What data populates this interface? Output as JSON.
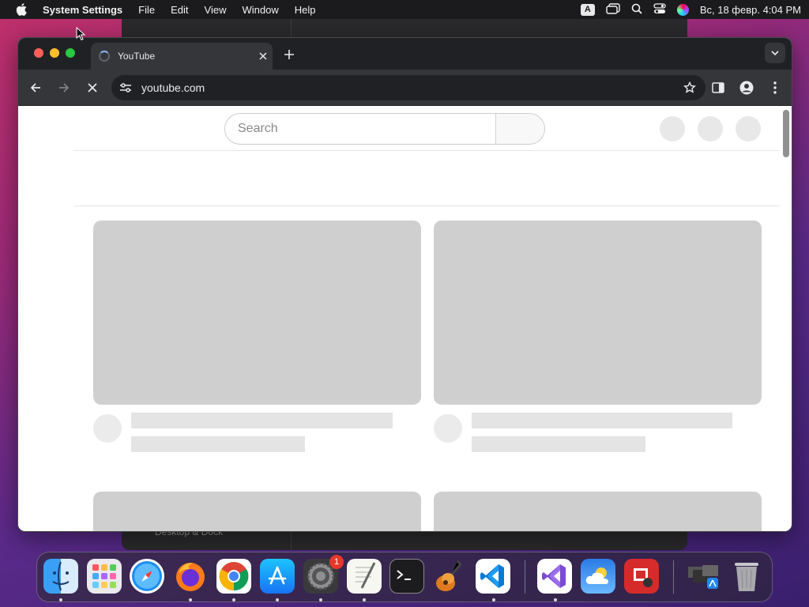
{
  "menubar": {
    "app_name": "System Settings",
    "menus": [
      "File",
      "Edit",
      "View",
      "Window",
      "Help"
    ],
    "input_source": "A",
    "datetime": "Вс, 18 февр.  4:04 PM"
  },
  "background_window": {
    "sidebar_item": "Desktop & Dock"
  },
  "browser": {
    "tab": {
      "title": "YouTube",
      "loading": true
    },
    "address": {
      "url": "youtube.com"
    }
  },
  "youtube": {
    "search_placeholder": "Search"
  },
  "dock": {
    "apps": [
      {
        "name": "Finder",
        "running": true
      },
      {
        "name": "Launchpad",
        "running": false
      },
      {
        "name": "Safari",
        "running": false
      },
      {
        "name": "Firefox",
        "running": true
      },
      {
        "name": "Chrome",
        "running": true
      },
      {
        "name": "App Store",
        "running": true
      },
      {
        "name": "System Settings",
        "running": true,
        "badge": "1"
      },
      {
        "name": "TextEdit",
        "running": true
      },
      {
        "name": "Terminal",
        "running": false
      },
      {
        "name": "GarageBand",
        "running": false
      },
      {
        "name": "VS Code",
        "running": true
      },
      {
        "name": "Visual Studio",
        "running": true
      },
      {
        "name": "Weather",
        "running": false
      },
      {
        "name": "Photo Booth",
        "running": false
      },
      {
        "name": "Downloads Stack",
        "running": false
      },
      {
        "name": "Trash",
        "running": false
      }
    ]
  },
  "colors": {
    "menubar_bg": "#1b1b1d",
    "browser_toolbar": "#35363a",
    "tabstrip": "#202124",
    "skeleton": "#cfcfcf"
  }
}
